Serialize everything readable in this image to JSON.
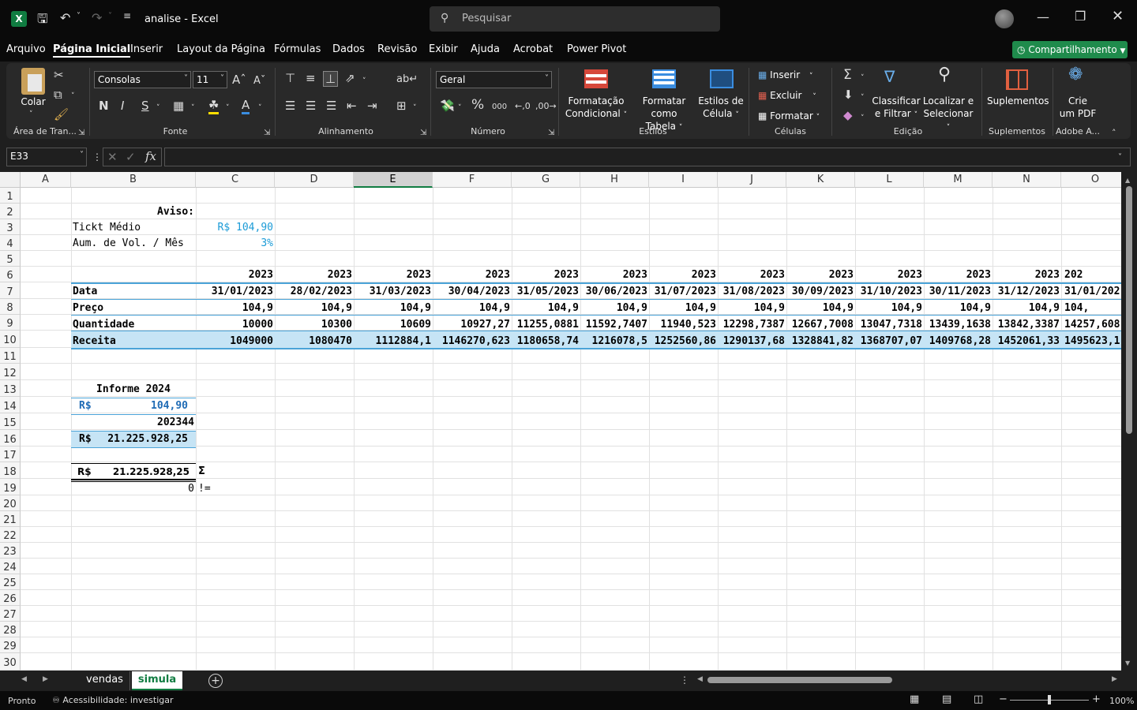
{
  "title": {
    "file": "analise",
    "app": "Excel",
    "separator": " - ",
    "search_placeholder": "Pesquisar"
  },
  "menu": [
    "Arquivo",
    "Página Inicial",
    "Inserir",
    "Layout da Página",
    "Fórmulas",
    "Dados",
    "Revisão",
    "Exibir",
    "Ajuda",
    "Acrobat",
    "Power Pivot"
  ],
  "share_label": "Compartilhamento",
  "ribbon": {
    "colar": "Colar",
    "area_transf": "Área de Tran...",
    "fonte": "Fonte",
    "font_name": "Consolas",
    "font_size": "11",
    "alinhamento": "Alinhamento",
    "numero": "Número",
    "number_format": "Geral",
    "formatacao_cond": [
      "Formatação",
      "Condicional"
    ],
    "formatar_tabela": [
      "Formatar como",
      "Tabela"
    ],
    "estilos_celula": [
      "Estilos de",
      "Célula"
    ],
    "estilos": "Estilos",
    "inserir": "Inserir",
    "excluir": "Excluir",
    "formatar": "Formatar",
    "celulas": "Células",
    "classificar": [
      "Classificar",
      "e Filtrar"
    ],
    "localizar": [
      "Localizar e",
      "Selecionar"
    ],
    "edicao": "Edição",
    "suplementos": "Suplementos",
    "suplementos_grp": "Suplementos",
    "crie_pdf": [
      "Crie",
      "um PDF"
    ],
    "adobe": "Adobe A..."
  },
  "namebox": "E33",
  "formula": "",
  "columns": [
    "A",
    "B",
    "C",
    "D",
    "E",
    "F",
    "G",
    "H",
    "I",
    "J",
    "K",
    "L",
    "M",
    "N",
    "O"
  ],
  "rows": [
    "1",
    "2",
    "3",
    "4",
    "5",
    "6",
    "7",
    "8",
    "9",
    "10",
    "11",
    "12",
    "13",
    "14",
    "15",
    "16",
    "17",
    "18",
    "19",
    "20",
    "21",
    "22",
    "23",
    "24",
    "25",
    "26",
    "27",
    "28",
    "29",
    "30"
  ],
  "cells": {
    "aviso": "Aviso:",
    "tickt": "Tickt Médio",
    "tickt_val": "R$ 104,90",
    "aum": "Aum. de Vol. / Mês",
    "aum_val": "3%",
    "years": [
      "2023",
      "2023",
      "2023",
      "2023",
      "2023",
      "2023",
      "2023",
      "2023",
      "2023",
      "2023",
      "2023",
      "2023",
      "202"
    ],
    "data_label": "Data",
    "dates": [
      "31/01/2023",
      "28/02/2023",
      "31/03/2023",
      "30/04/2023",
      "31/05/2023",
      "30/06/2023",
      "31/07/2023",
      "31/08/2023",
      "30/09/2023",
      "31/10/2023",
      "30/11/2023",
      "31/12/2023",
      "31/01/202"
    ],
    "preco_label": "Preço",
    "precos": [
      "104,9",
      "104,9",
      "104,9",
      "104,9",
      "104,9",
      "104,9",
      "104,9",
      "104,9",
      "104,9",
      "104,9",
      "104,9",
      "104,9",
      "104,"
    ],
    "qtd_label": "Quantidade",
    "qtds": [
      "10000",
      "10300",
      "10609",
      "10927,27",
      "11255,0881",
      "11592,7407",
      "11940,523",
      "12298,7387",
      "12667,7008",
      "13047,7318",
      "13439,1638",
      "13842,3387",
      "14257,608"
    ],
    "receita_label": "Receita",
    "receitas": [
      "1049000",
      "1080470",
      "1112884,1",
      "1146270,623",
      "1180658,74",
      "1216078,5",
      "1252560,86",
      "1290137,68",
      "1328841,82",
      "1368707,07",
      "1409768,28",
      "1452061,33",
      "1495623,1"
    ],
    "informe": "Informe 2024",
    "rs": "R$",
    "inf_preco": "104,90",
    "inf_qtd": "202344",
    "inf_total": "21.225.928,25",
    "sum_total": "21.225.928,25",
    "sigma": "Σ",
    "zero": "0",
    "neq": "!="
  },
  "sheets": [
    "vendas",
    "simula"
  ],
  "status": {
    "ready": "Pronto",
    "access": "Acessibilidade: investigar",
    "zoom": "100%"
  }
}
